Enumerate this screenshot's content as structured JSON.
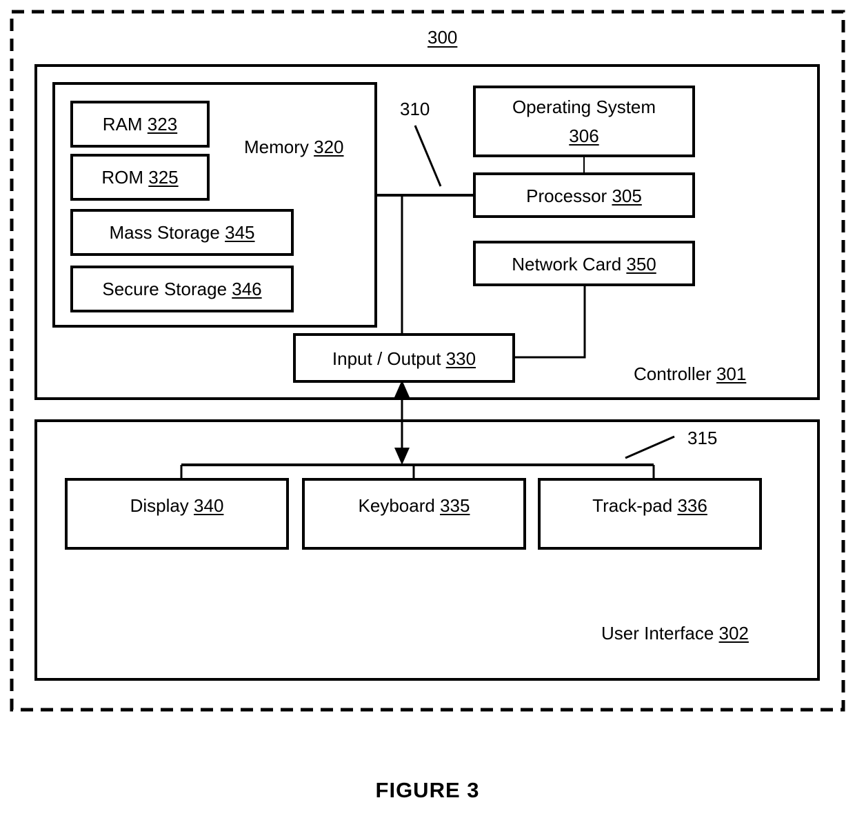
{
  "figure": {
    "caption": "FIGURE 3",
    "system_ref": "300"
  },
  "containers": {
    "controller": {
      "label": "Controller ",
      "ref": "301"
    },
    "user_interface": {
      "label": "User Interface ",
      "ref": "302"
    },
    "memory": {
      "label": "Memory ",
      "ref": "320"
    }
  },
  "memory_blocks": [
    {
      "label": "RAM ",
      "ref": "323"
    },
    {
      "label": "ROM ",
      "ref": "325"
    },
    {
      "label": "Mass Storage ",
      "ref": "345"
    },
    {
      "label": "Secure Storage ",
      "ref": "346"
    }
  ],
  "controller_blocks": [
    {
      "label": "Operating System",
      "label2": "",
      "ref": "306"
    },
    {
      "label": "Processor ",
      "ref": "305"
    },
    {
      "label": "Network Card ",
      "ref": "350"
    },
    {
      "label": "Input / Output ",
      "ref": "330"
    }
  ],
  "ui_blocks": [
    {
      "label": "Display  ",
      "ref": "340"
    },
    {
      "label": "Keyboard ",
      "ref": "335"
    },
    {
      "label": "Track-pad ",
      "ref": "336"
    }
  ],
  "bus_refs": {
    "controller_bus": "310",
    "ui_bus": "315"
  },
  "colors": {
    "line": "#000000",
    "background": "#ffffff"
  }
}
